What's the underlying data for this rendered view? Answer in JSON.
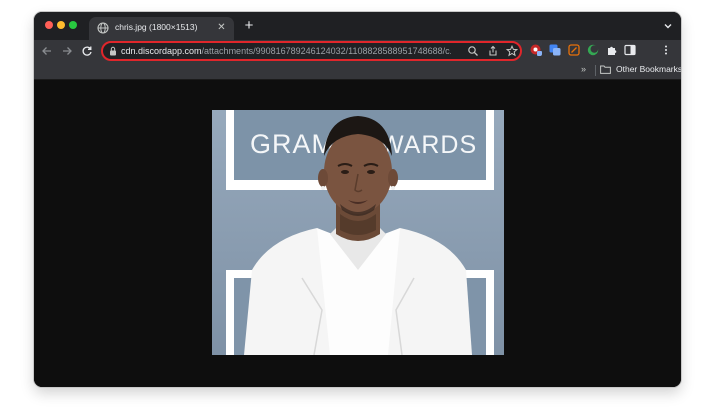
{
  "tab": {
    "title": "chris.jpg (1800×1513)"
  },
  "toolbar": {
    "url_host": "cdn.discordapp.com",
    "url_path": "/attachments/990816789246124032/1108828588951748688/c..."
  },
  "bookmarks": {
    "chevron": "»",
    "other": "Other Bookmarks"
  },
  "content": {
    "image_text": "GRAMMY AWARDS",
    "image_description": "photo of a man in a white suit in front of a Grammy Awards backdrop"
  },
  "icons": {
    "back": "arrow-left-icon",
    "forward": "arrow-right-icon",
    "reload": "reload-icon",
    "lock": "lock-icon",
    "zoom": "magnifier-icon",
    "share": "share-icon",
    "bookmark": "star-icon",
    "extensions": "puzzle-icon",
    "side_panel": "side-panel-icon",
    "menu": "kebab-menu-icon"
  },
  "colors": {
    "window_bg": "#0e0e0e",
    "toolbar": "#35363a",
    "tabstrip": "#1f2023",
    "omnibox_highlight": "#e0262b",
    "backdrop": "#8da0b4"
  }
}
